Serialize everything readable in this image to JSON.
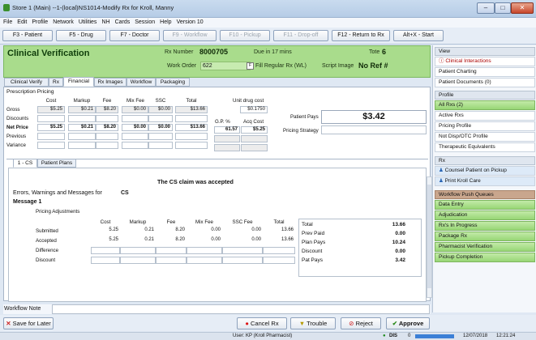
{
  "window": {
    "title": "Store 1 (Main) --1-(local)NS1014-Modify Rx for Kroll, Manny"
  },
  "menu": [
    "File",
    "Edit",
    "Profile",
    "Network",
    "Utilities",
    "NH",
    "Cards",
    "Session",
    "Help",
    "Version 10"
  ],
  "fkeys": [
    "F3 - Patient",
    "F5 - Drug",
    "F7 - Doctor",
    "F9 - Workflow",
    "F10 - Pickup",
    "F11 - Drop-off",
    "F12 - Return to Rx",
    "Alt+X - Start"
  ],
  "header": {
    "title": "Clinical Verification",
    "rx_label": "Rx Number",
    "rx_value": "8000705",
    "due": "Due in 17 mins",
    "tote_label": "Tote",
    "tote_value": "6",
    "work_order_label": "Work Order",
    "work_order_value": "622",
    "fill_type": "Fill Regular Rx (WL)",
    "script_label": "Script Image",
    "script_value": "No Ref #"
  },
  "tabs": [
    "Clinical Verify",
    "Rx",
    "Financial",
    "Rx Images",
    "Workflow",
    "Packaging"
  ],
  "pricing": {
    "title": "Prescription Pricing",
    "cols": [
      "Cost",
      "Markup",
      "Fee",
      "Mix Fee",
      "SSC",
      "Total"
    ],
    "rows": [
      {
        "label": "Gross",
        "vals": [
          "$5.25",
          "$0.21",
          "$8.20",
          "$0.00",
          "$0.00",
          "$13.66"
        ]
      },
      {
        "label": "Discounts",
        "vals": [
          "",
          "",
          "",
          "",
          "",
          ""
        ]
      },
      {
        "label": "Net Price",
        "vals": [
          "$5.25",
          "$0.21",
          "$8.20",
          "$0.00",
          "$0.00",
          "$13.66"
        ]
      },
      {
        "label": "Previous",
        "vals": [
          "",
          "",
          "",
          "",
          "",
          ""
        ]
      },
      {
        "label": "Variance",
        "vals": [
          "",
          "",
          "",
          "",
          "",
          ""
        ]
      }
    ],
    "unit_cost_label": "Unit drug cost",
    "unit_cost": "$0.1750",
    "gp_label": "G.P. %",
    "acq_label": "Acq Cost",
    "gp": "61.57",
    "acq": "$5.25",
    "patient_pays_label": "Patient Pays",
    "patient_pays": "$3.42",
    "strategy_label": "Pricing Strategy"
  },
  "plan_tabs": [
    "1 - CS",
    "Patient Plans (2)"
  ],
  "claim": {
    "accepted": "The CS claim was accepted",
    "errors_label": "Errors, Warnings and Messages for",
    "errors_plan": "CS",
    "message": "Message 1",
    "adj_title": "Pricing Adjustments",
    "cols": [
      "Cost",
      "Markup",
      "Fee",
      "Mix Fee",
      "SSC Fee",
      "Total"
    ],
    "rows": [
      {
        "label": "Submitted",
        "vals": [
          "5.25",
          "0.21",
          "8.20",
          "0.00",
          "0.00",
          "13.66"
        ]
      },
      {
        "label": "Accepted",
        "vals": [
          "5.25",
          "0.21",
          "8.20",
          "0.00",
          "0.00",
          "13.66"
        ]
      },
      {
        "label": "Difference",
        "vals": [
          "",
          "",
          "",
          "",
          "",
          ""
        ]
      },
      {
        "label": "Discount",
        "vals": [
          "",
          "",
          "",
          "",
          "",
          ""
        ]
      }
    ],
    "totals": [
      {
        "label": "Total",
        "value": "13.66"
      },
      {
        "label": "Prev Paid",
        "value": "0.00"
      },
      {
        "label": "Plan Pays",
        "value": "10.24"
      },
      {
        "label": "Discount",
        "value": "0.00"
      },
      {
        "label": "Pat Pays",
        "value": "3.42"
      }
    ]
  },
  "workflow_note_label": "Workflow Note",
  "buttons": {
    "save": "Save for Later",
    "cancel": "Cancel Rx",
    "trouble": "Trouble",
    "reject": "Reject",
    "approve": "Approve"
  },
  "right": {
    "view": "View",
    "view_items": [
      "Clinical Interactions",
      "Patient Charting",
      "Patient Documents (0)"
    ],
    "profile": "Profile",
    "profile_items": [
      "All Rxs (2)",
      "Active Rxs",
      "Pricing Profile",
      "Not Disp/OTC Profile",
      "Therapeutic Equivalents"
    ],
    "rx": "Rx",
    "rx_items": [
      "Counsel Patient on Pickup",
      "Print Kroll Care"
    ],
    "queues": "Workflow Push Queues",
    "queue_items": [
      "Data Entry",
      "Adjudication",
      "Rx's In Progress",
      "Package Rx",
      "Pharmacist Verification",
      "Pickup Completion"
    ]
  },
  "status": {
    "user": "User: KP (Kroll Pharmacist)",
    "dis": "DIS",
    "count": "0",
    "date": "12/07/2018",
    "time": "12:21:24"
  },
  "colors": {
    "header_green": "#a9dc8c",
    "queue_green": "#98d675",
    "approve_green": "#2a8a1a"
  }
}
